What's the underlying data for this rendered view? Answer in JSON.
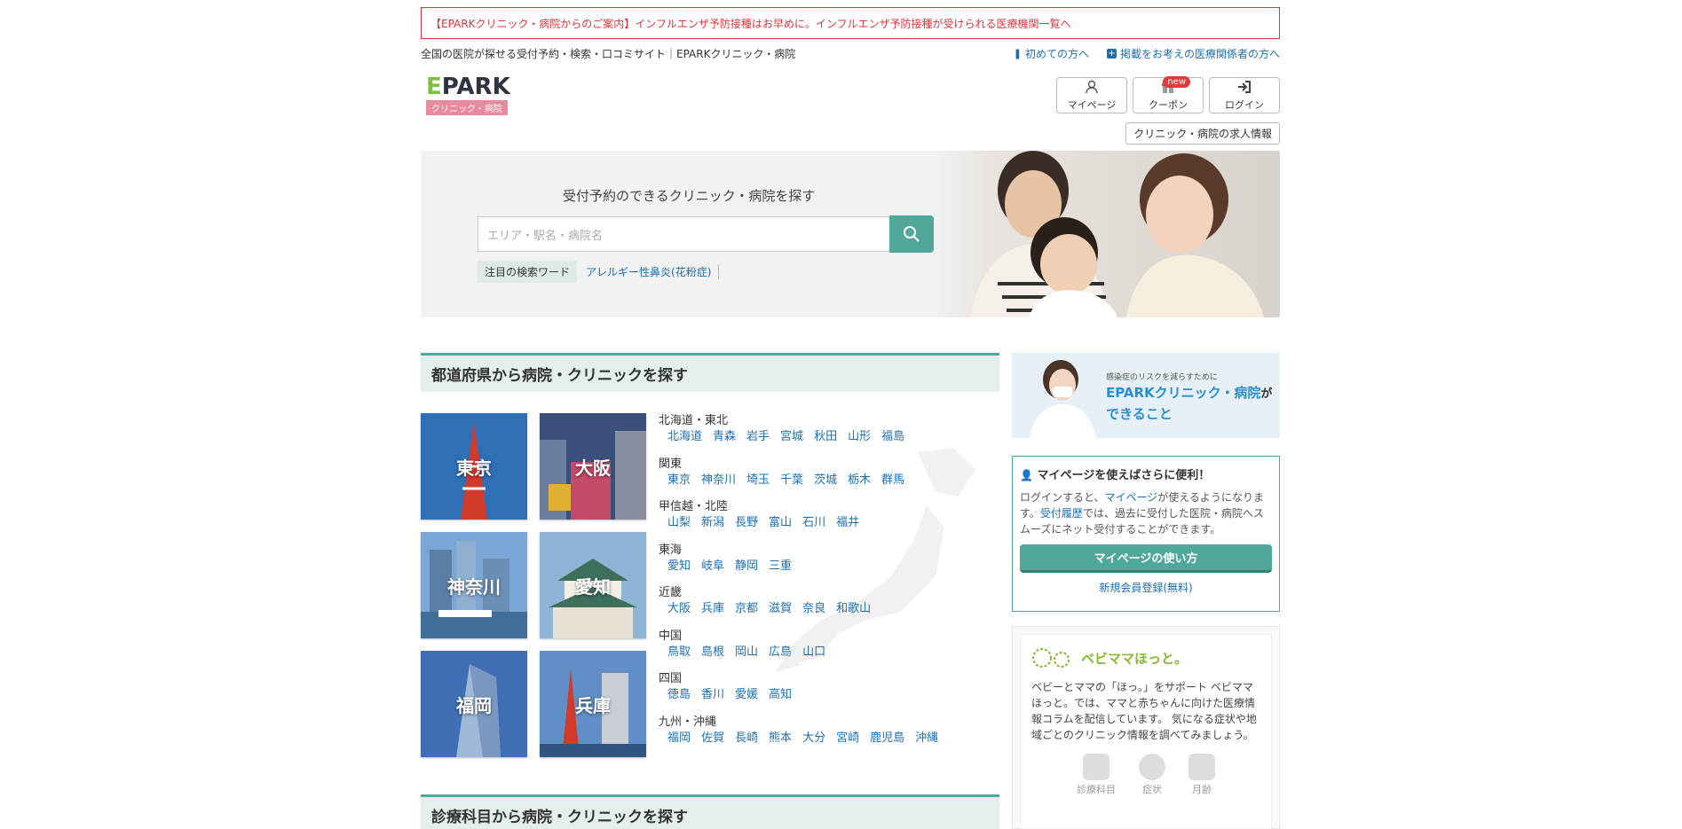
{
  "notice": {
    "text": "【EPARKクリニック・病院からのご案内】インフルエンザ予防接種はお早めに。インフルエンザ予防接種が受けられる医療機関一覧へ"
  },
  "header": {
    "tagline": "全国の医院が探せる受付予約・検索・口コミサイト｜EPARKクリニック・病院",
    "first_time_link": "初めての方へ",
    "listing_link": "掲載をお考えの医療関係者の方へ",
    "logo_text": "EPARK",
    "logo_sub": "クリニック・病院",
    "buttons": [
      {
        "label": "マイページ",
        "icon": "user-icon"
      },
      {
        "label": "クーポン",
        "icon": "gift-icon",
        "badge": "new"
      },
      {
        "label": "ログイン",
        "icon": "login-icon"
      }
    ],
    "recruit_label": "クリニック・病院の求人情報"
  },
  "hero": {
    "title": "受付予約のできるクリニック・病院を探す",
    "search_placeholder": "エリア・駅名・病院名",
    "keyword_label": "注目の検索ワード",
    "keywords": [
      "アレルギー性鼻炎(花粉症)"
    ]
  },
  "prefecture_section": {
    "title": "都道府県から病院・クリニックを探す",
    "tiles": [
      "東京",
      "大阪",
      "神奈川",
      "愛知",
      "福岡",
      "兵庫"
    ],
    "regions": [
      {
        "name": "北海道・東北",
        "prefs": [
          "北海道",
          "青森",
          "岩手",
          "宮城",
          "秋田",
          "山形",
          "福島"
        ]
      },
      {
        "name": "関東",
        "prefs": [
          "東京",
          "神奈川",
          "埼玉",
          "千葉",
          "茨城",
          "栃木",
          "群馬"
        ]
      },
      {
        "name": "甲信越・北陸",
        "prefs": [
          "山梨",
          "新潟",
          "長野",
          "富山",
          "石川",
          "福井"
        ]
      },
      {
        "name": "東海",
        "prefs": [
          "愛知",
          "岐阜",
          "静岡",
          "三重"
        ]
      },
      {
        "name": "近畿",
        "prefs": [
          "大阪",
          "兵庫",
          "京都",
          "滋賀",
          "奈良",
          "和歌山"
        ]
      },
      {
        "name": "中国",
        "prefs": [
          "鳥取",
          "島根",
          "岡山",
          "広島",
          "山口"
        ]
      },
      {
        "name": "四国",
        "prefs": [
          "徳島",
          "香川",
          "愛媛",
          "高知"
        ]
      },
      {
        "name": "九州・沖縄",
        "prefs": [
          "福岡",
          "佐賀",
          "長崎",
          "熊本",
          "大分",
          "宮崎",
          "鹿児島",
          "沖縄"
        ]
      }
    ]
  },
  "department_section": {
    "title": "診療科目から病院・クリニックを探す"
  },
  "sidebar": {
    "banner": {
      "small": "感染症のリスクを減らすために",
      "line1": "EPARKクリニック・病院",
      "line1_suffix": "が",
      "line2": "できること"
    },
    "mypage": {
      "title": "マイページを使えばさらに便利！",
      "body_1": "ログインすると、",
      "body_link1": "マイページ",
      "body_2": "が使えるようになります。",
      "body_link2": "受付履歴",
      "body_3": "では、過去に受付した医院・病院へスムーズにネット受付することができます。",
      "button": "マイページの使い方",
      "register": "新規会員登録(無料)"
    },
    "baby": {
      "logo_text": "ベビママほっと。",
      "text": "ベビーとママの「ほっ。」をサポート ベビママほっと。では、ママと赤ちゃんに向けた医療情報コラムを配信しています。 気になる症状や地域ごとのクリニック情報を調べてみましょう。",
      "icons": [
        "診療科目",
        "症状",
        "月齢"
      ]
    }
  },
  "colors": {
    "accent": "#4fa89a",
    "link": "#1b6fb0",
    "notice": "#d9363e"
  }
}
